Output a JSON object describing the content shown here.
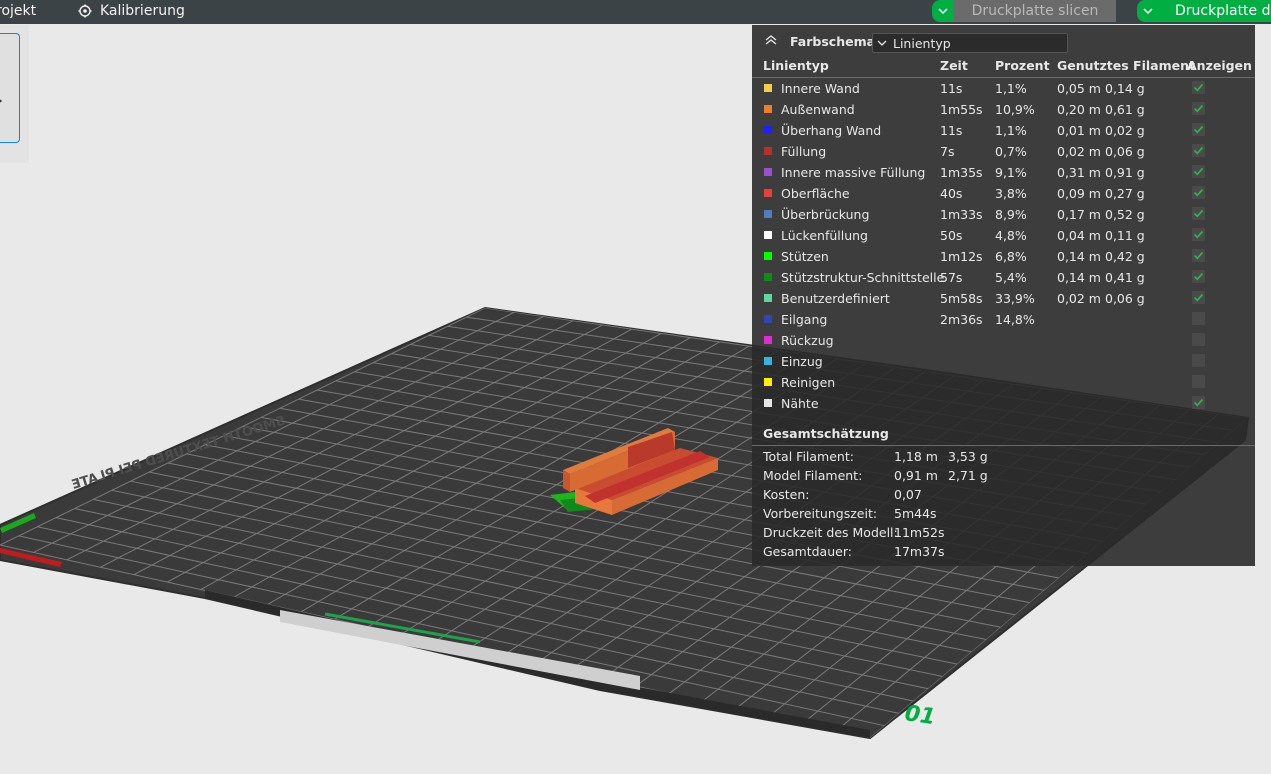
{
  "topbar": {
    "project_label": "rojekt",
    "calibration_label": "Kalibrierung",
    "slice_button": "Druckplatte slicen",
    "print_button": "Druckplatte d"
  },
  "bed": {
    "brand_text": "SMOOTH TEXTURED PEI PLATE",
    "plate_number": "01"
  },
  "colors": {
    "accent_green": "#00ae42",
    "panel_bg": "#2a2a2a",
    "checkbox_check": "#2fb34a"
  },
  "panel": {
    "scheme_label": "Farbschema",
    "scheme_value": "Linientyp",
    "headers": {
      "type": "Linientyp",
      "time": "Zeit",
      "percent": "Prozent",
      "filament": "Genutztes Filament",
      "show": "Anzeigen"
    },
    "rows": [
      {
        "label": "Innere Wand",
        "color": "#f3cd4a",
        "time": "11s",
        "pct": "1,1%",
        "m": "0,05 m",
        "g": "0,14 g",
        "checked": true
      },
      {
        "label": "Außenwand",
        "color": "#ef7d30",
        "time": "1m55s",
        "pct": "10,9%",
        "m": "0,20 m",
        "g": "0,61 g",
        "checked": true
      },
      {
        "label": "Überhang Wand",
        "color": "#1c21ff",
        "time": "11s",
        "pct": "1,1%",
        "m": "0,01 m",
        "g": "0,02 g",
        "checked": true
      },
      {
        "label": "Füllung",
        "color": "#b7312a",
        "time": "7s",
        "pct": "0,7%",
        "m": "0,02 m",
        "g": "0,06 g",
        "checked": true
      },
      {
        "label": "Innere massive Füllung",
        "color": "#9a4fd1",
        "time": "1m35s",
        "pct": "9,1%",
        "m": "0,31 m",
        "g": "0,91 g",
        "checked": true
      },
      {
        "label": "Oberfläche",
        "color": "#e7403c",
        "time": "40s",
        "pct": "3,8%",
        "m": "0,09 m",
        "g": "0,27 g",
        "checked": true
      },
      {
        "label": "Überbrückung",
        "color": "#4b7fbf",
        "time": "1m33s",
        "pct": "8,9%",
        "m": "0,17 m",
        "g": "0,52 g",
        "checked": true
      },
      {
        "label": "Lückenfüllung",
        "color": "#ffffff",
        "time": "50s",
        "pct": "4,8%",
        "m": "0,04 m",
        "g": "0,11 g",
        "checked": true
      },
      {
        "label": "Stützen",
        "color": "#00ff00",
        "time": "1m12s",
        "pct": "6,8%",
        "m": "0,14 m",
        "g": "0,42 g",
        "checked": true
      },
      {
        "label": "Stützstruktur-Schnittstelle",
        "color": "#0f8a1a",
        "time": "57s",
        "pct": "5,4%",
        "m": "0,14 m",
        "g": "0,41 g",
        "checked": true
      },
      {
        "label": "Benutzerdefiniert",
        "color": "#5fd4a0",
        "time": "5m58s",
        "pct": "33,9%",
        "m": "0,02 m",
        "g": "0,06 g",
        "checked": true
      },
      {
        "label": "Eilgang",
        "color": "#3346b5",
        "time": "2m36s",
        "pct": "14,8%",
        "m": "",
        "g": "",
        "checked": false
      },
      {
        "label": "Rückzug",
        "color": "#e329d4",
        "time": "",
        "pct": "",
        "m": "",
        "g": "",
        "checked": false
      },
      {
        "label": "Einzug",
        "color": "#35b4e0",
        "time": "",
        "pct": "",
        "m": "",
        "g": "",
        "checked": false
      },
      {
        "label": "Reinigen",
        "color": "#ffee00",
        "time": "",
        "pct": "",
        "m": "",
        "g": "",
        "checked": false
      },
      {
        "label": "Nähte",
        "color": "#e6e6e6",
        "time": "",
        "pct": "",
        "m": "",
        "g": "",
        "checked": true
      }
    ],
    "summary_title": "Gesamtschätzung",
    "summary": [
      {
        "label": "Total Filament:",
        "v1": "1,18 m",
        "v2": "3,53 g"
      },
      {
        "label": "Model Filament:",
        "v1": "0,91 m",
        "v2": "2,71 g"
      },
      {
        "label": "Kosten:",
        "v1": "0,07",
        "v2": ""
      },
      {
        "label": "Vorbereitungszeit:",
        "v1": "5m44s",
        "v2": ""
      },
      {
        "label": "Druckzeit des Modell:",
        "v1": "11m52s",
        "v2": ""
      },
      {
        "label": "Gesamtdauer:",
        "v1": "17m37s",
        "v2": ""
      }
    ]
  }
}
